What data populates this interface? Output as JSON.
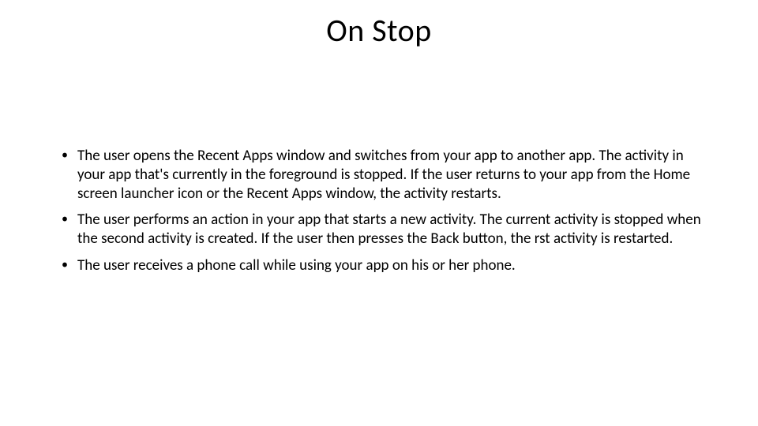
{
  "slide": {
    "title": "On Stop",
    "bullets": [
      "The user opens the Recent Apps window and switches from your app to another app. The activity in your app that's currently in the foreground is stopped. If the user returns to your app from the Home screen launcher icon or the Recent Apps window, the activity restarts.",
      "The user performs an action in your app that starts a new activity. The current activity is stopped when the second activity is created. If the user then presses the Back button, the rst activity is restarted.",
      " The user receives a phone call while using your app on his or her phone."
    ]
  }
}
